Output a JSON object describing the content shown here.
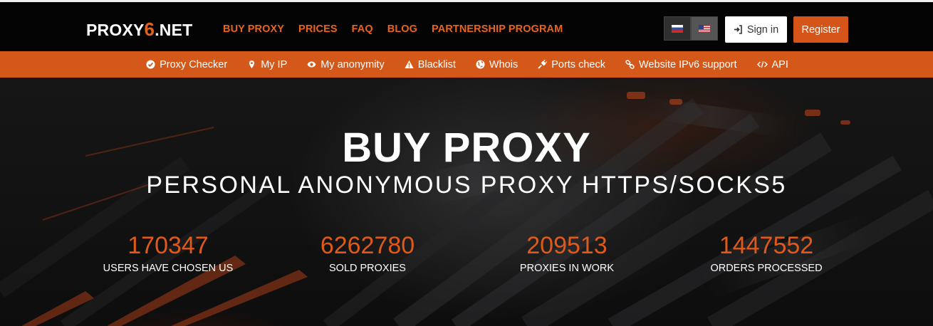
{
  "logo": {
    "prefix": "PROXY",
    "digit": "6",
    "suffix": ".NET"
  },
  "nav": [
    {
      "label": "BUY PROXY"
    },
    {
      "label": "PRICES"
    },
    {
      "label": "FAQ"
    },
    {
      "label": "BLOG"
    },
    {
      "label": "PARTNERSHIP PROGRAM"
    }
  ],
  "languages": [
    {
      "icon": "flag-ru-icon",
      "active": false
    },
    {
      "icon": "flag-us-icon",
      "active": true
    }
  ],
  "auth": {
    "signin_label": "Sign in",
    "register_label": "Register"
  },
  "tools": [
    {
      "label": "Proxy Checker",
      "icon": "check-circle-icon"
    },
    {
      "label": "My IP",
      "icon": "map-pin-icon"
    },
    {
      "label": "My anonymity",
      "icon": "eye-icon"
    },
    {
      "label": "Blacklist",
      "icon": "warning-icon"
    },
    {
      "label": "Whois",
      "icon": "globe-icon"
    },
    {
      "label": "Ports check",
      "icon": "plug-icon"
    },
    {
      "label": "Website IPv6 support",
      "icon": "link-icon"
    },
    {
      "label": "API",
      "icon": "code-icon"
    }
  ],
  "hero": {
    "title": "BUY PROXY",
    "subtitle": "PERSONAL ANONYMOUS PROXY HTTPS/SOCKS5"
  },
  "stats": [
    {
      "value": "170347",
      "label": "USERS HAVE CHOSEN US"
    },
    {
      "value": "6262780",
      "label": "SOLD PROXIES"
    },
    {
      "value": "209513",
      "label": "PROXIES IN WORK"
    },
    {
      "value": "1447552",
      "label": "ORDERS PROCESSED"
    }
  ],
  "colors": {
    "accent": "#d4581a",
    "accent_text": "#e8641d",
    "topbar": "#040404"
  }
}
